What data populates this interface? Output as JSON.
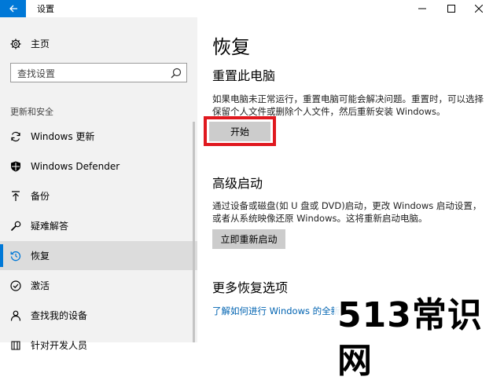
{
  "window": {
    "title": "设置",
    "accent": "#0078d7"
  },
  "sidebar": {
    "home_label": "主页",
    "search": {
      "placeholder": "查找设置"
    },
    "section_label": "更新和安全",
    "items": [
      {
        "label": "Windows 更新",
        "icon": "sync-icon",
        "selected": false
      },
      {
        "label": "Windows Defender",
        "icon": "shield-icon",
        "selected": false
      },
      {
        "label": "备份",
        "icon": "backup-arrow-icon",
        "selected": false
      },
      {
        "label": "疑难解答",
        "icon": "wrench-icon",
        "selected": false
      },
      {
        "label": "恢复",
        "icon": "history-icon",
        "selected": true
      },
      {
        "label": "激活",
        "icon": "check-circle-icon",
        "selected": false
      },
      {
        "label": "查找我的设备",
        "icon": "person-location-icon",
        "selected": false
      },
      {
        "label": "针对开发人员",
        "icon": "developer-icon",
        "selected": false
      }
    ]
  },
  "main": {
    "title": "恢复",
    "reset": {
      "heading": "重置此电脑",
      "description": "如果电脑未正常运行，重置电脑可能会解决问题。重置时，可以选择保留个人文件或删除个人文件，然后重新安装 Windows。",
      "button_label": "开始"
    },
    "advanced": {
      "heading": "高级启动",
      "description": "通过设备或磁盘(如 U 盘或 DVD)启动，更改 Windows 启动设置，或者从系统映像还原 Windows。这将重新启动电脑。",
      "button_label": "立即重新启动"
    },
    "more": {
      "heading": "更多恢复选项",
      "link": "了解如何进行 Windows 的全新"
    }
  },
  "watermark": "513常识网",
  "colors": {
    "sidebar_bg": "#f2f2f2",
    "button_bg": "#cccccc",
    "highlight": "#e0191f",
    "link": "#0063b1"
  }
}
